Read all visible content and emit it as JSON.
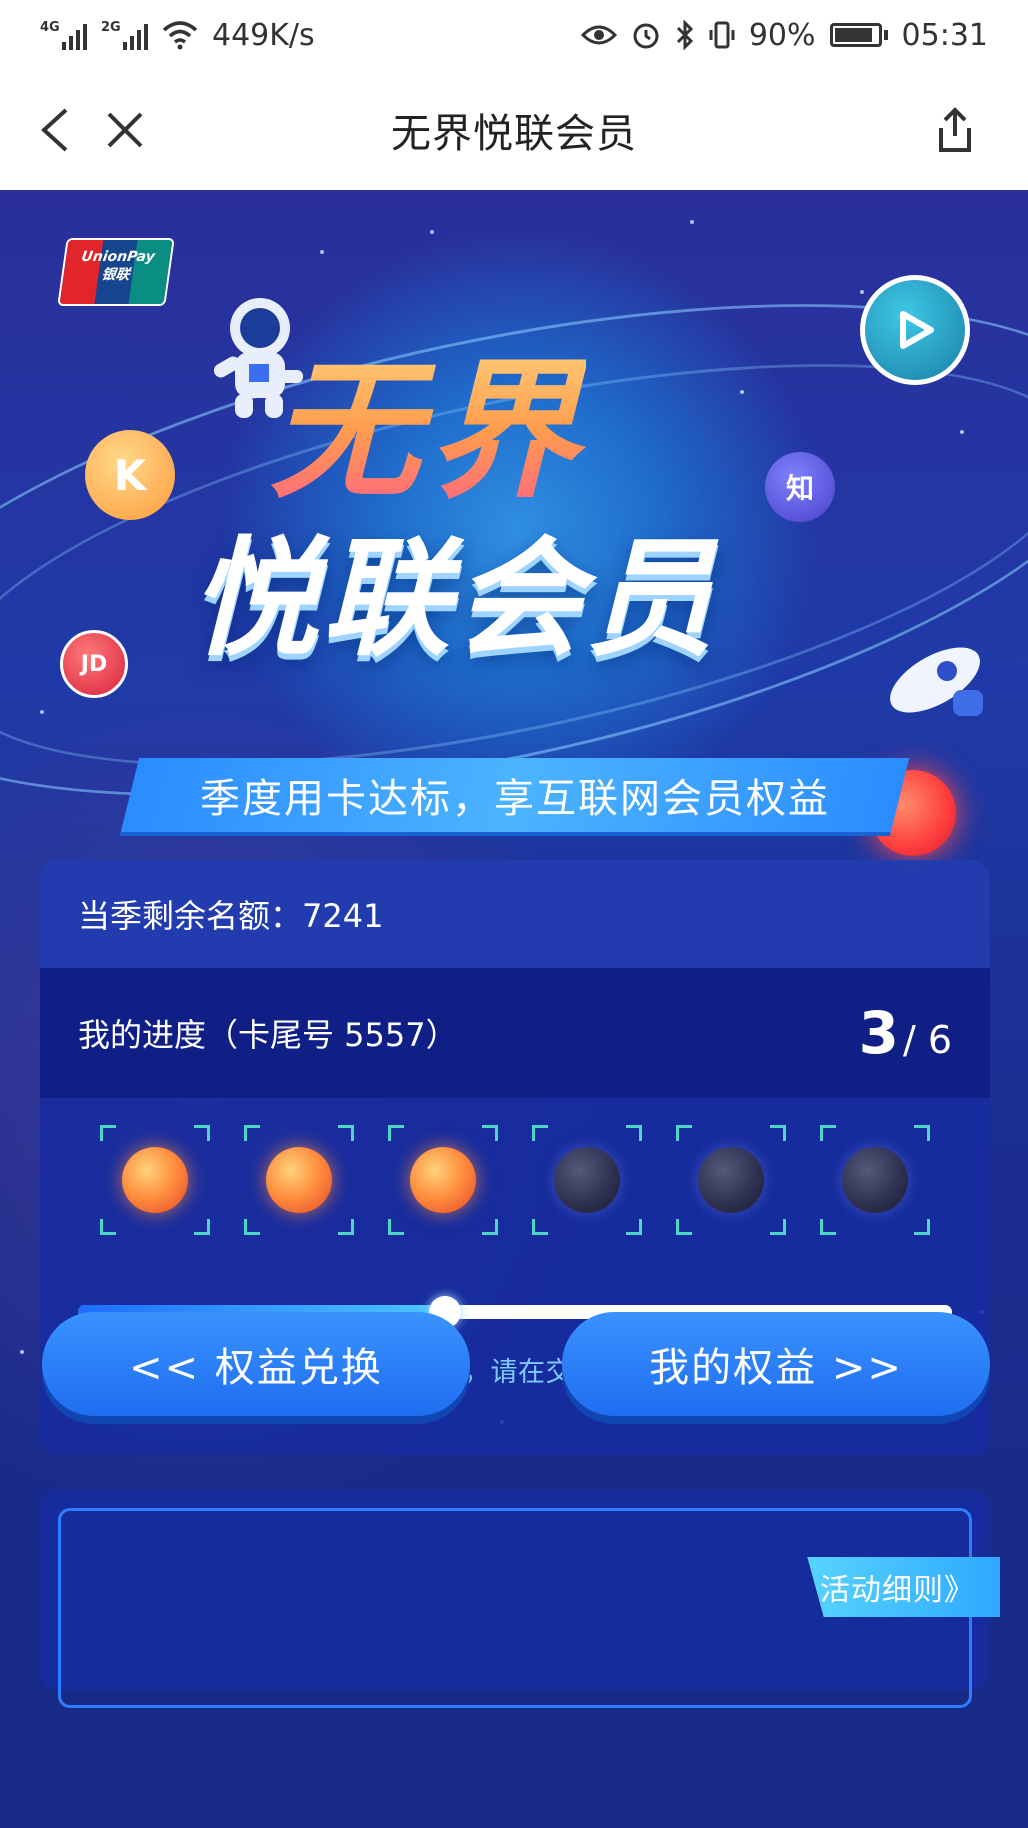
{
  "status_bar": {
    "net_1": "4G",
    "net_2": "2G",
    "speed": "449K/s",
    "battery": "90%",
    "time": "05:31"
  },
  "nav": {
    "title": "无界悦联会员"
  },
  "hero": {
    "logo_text_1": "UnionPay",
    "logo_text_2": "银联",
    "title_line_1": "无界",
    "title_line_2": "悦联会员",
    "slogan": "季度用卡达标，享互联网会员权益",
    "coin_k": "K",
    "coin_zhi": "知",
    "coin_jd": "JD"
  },
  "quota": {
    "label": "当季剩余名额：7241"
  },
  "progress": {
    "label": "我的进度（卡尾号 5557）",
    "current": "3",
    "total": "/ 6",
    "fraction": 0.42,
    "slots": [
      true,
      true,
      true,
      false,
      false,
      false
    ],
    "notice": "因网络原因等可能进度显示延迟，请在交易完成30分钟再次查询"
  },
  "buttons": {
    "exchange": "<< 权益兑换",
    "my_benefits": "我的权益 >>"
  },
  "rules": {
    "label": "活动细则》"
  },
  "colors": {
    "accent": "#1f6df0",
    "progress_on": "#ff8a3c",
    "notice": "#7ecbff"
  }
}
